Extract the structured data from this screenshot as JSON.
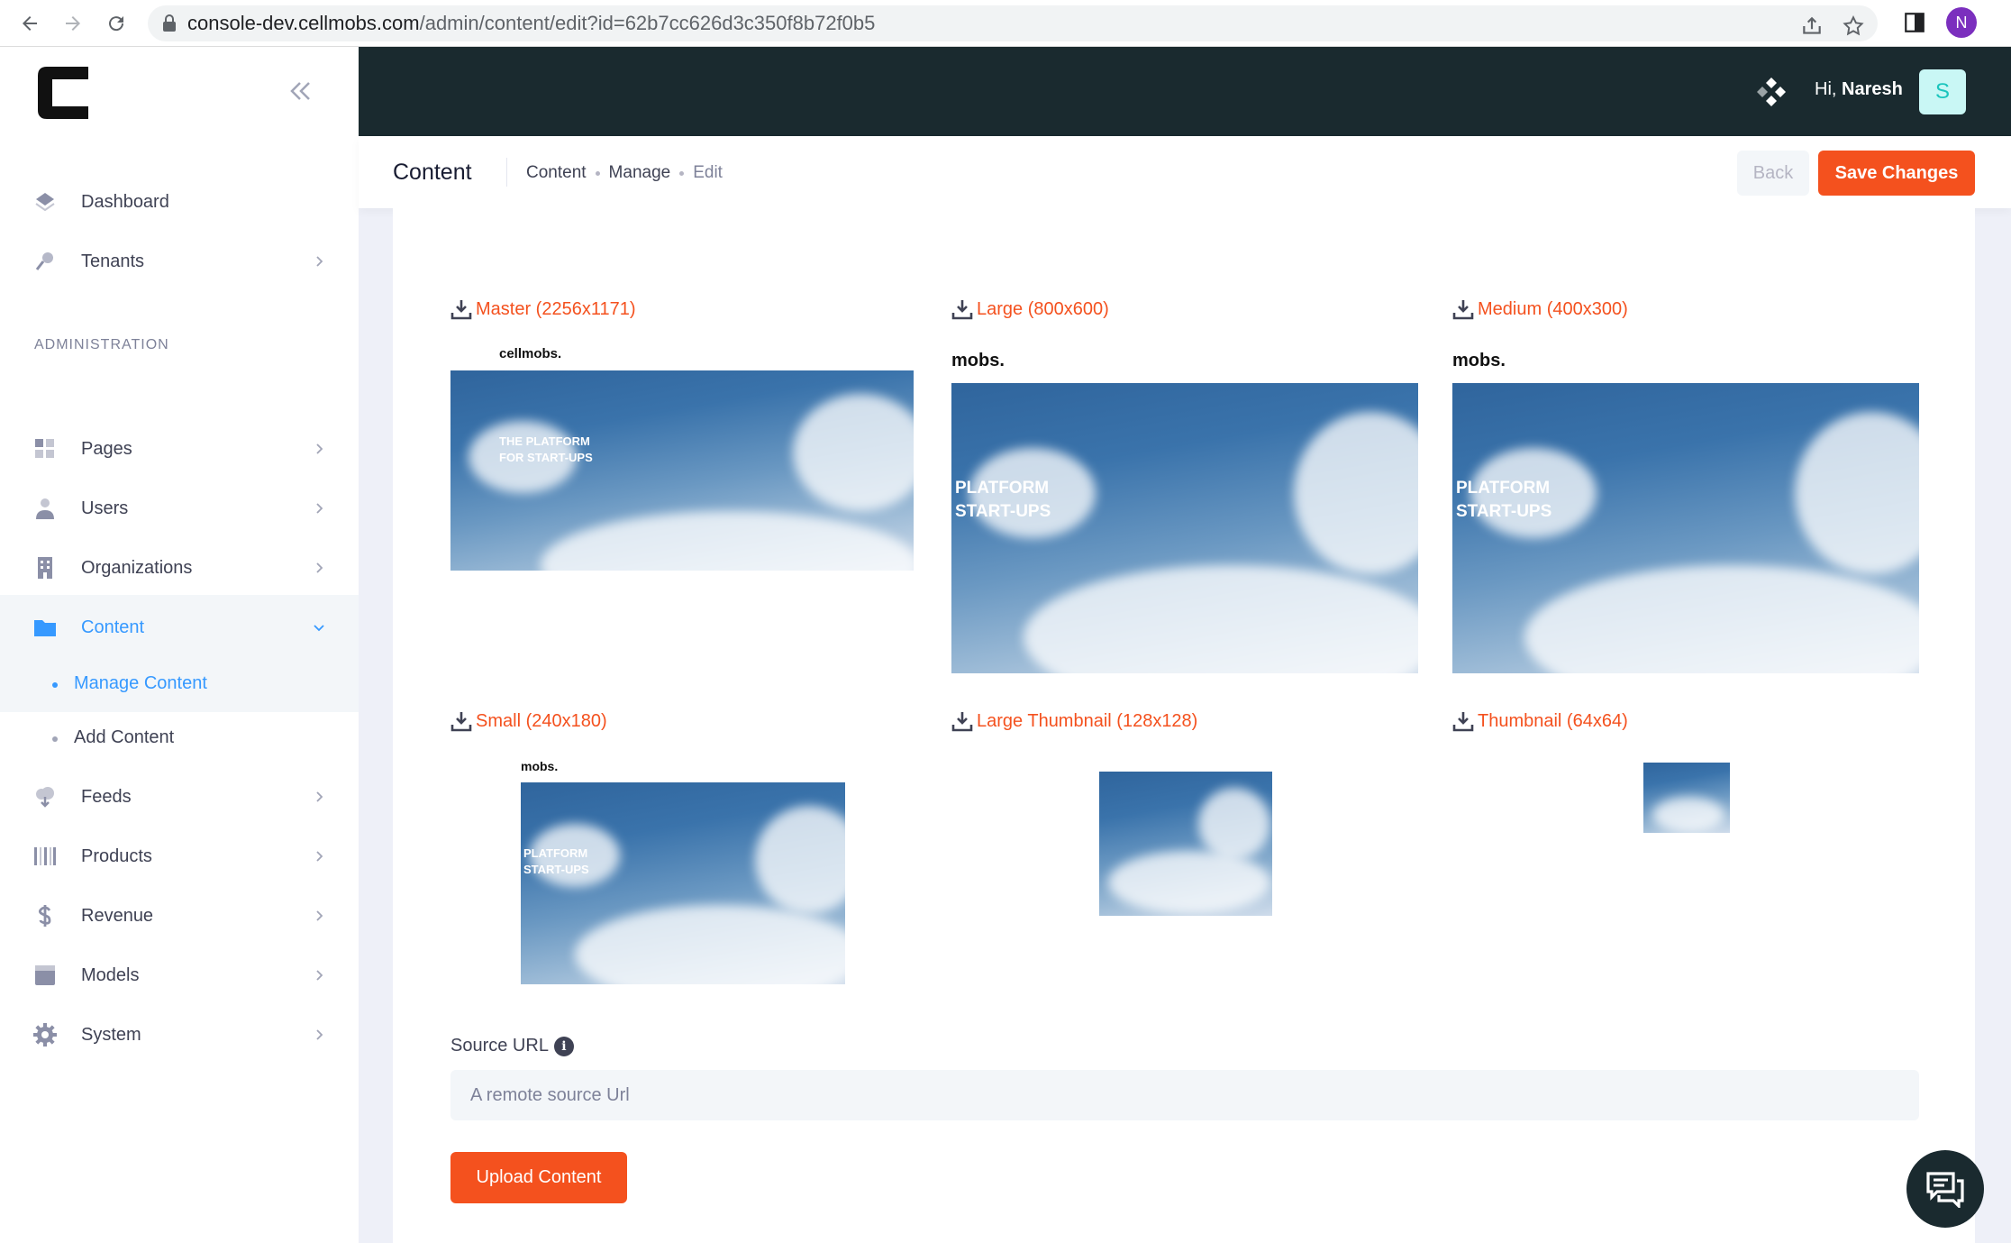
{
  "browser": {
    "url_host": "console-dev.cellmobs.com",
    "url_path": "/admin/content/edit?id=62b7cc626d3c350f8b72f0b5",
    "profile_initial": "N"
  },
  "sidebar": {
    "section_label": "ADMINISTRATION",
    "items": [
      {
        "label": "Dashboard"
      },
      {
        "label": "Tenants"
      },
      {
        "label": "Pages"
      },
      {
        "label": "Users"
      },
      {
        "label": "Organizations"
      },
      {
        "label": "Content"
      },
      {
        "label": "Feeds"
      },
      {
        "label": "Products"
      },
      {
        "label": "Revenue"
      },
      {
        "label": "Models"
      },
      {
        "label": "System"
      }
    ],
    "content_sub": [
      {
        "label": "Manage Content"
      },
      {
        "label": "Add Content"
      }
    ]
  },
  "topbar": {
    "greeting_prefix": "Hi,",
    "user_name": "Naresh",
    "avatar_initial": "S"
  },
  "subheader": {
    "title": "Content",
    "breadcrumbs": [
      "Content",
      "Manage",
      "Edit"
    ],
    "back_label": "Back",
    "save_label": "Save Changes"
  },
  "images": [
    {
      "label": "Master (2256x1171)",
      "brand": "cellmobs.",
      "hero": [
        "THE PLATFORM",
        "FOR START-UPS"
      ]
    },
    {
      "label": "Large (800x600)",
      "brand": "mobs.",
      "hero": [
        "PLATFORM",
        "START-UPS"
      ]
    },
    {
      "label": "Medium (400x300)",
      "brand": "mobs.",
      "hero": [
        "PLATFORM",
        "START-UPS"
      ]
    },
    {
      "label": "Small (240x180)",
      "brand": "mobs.",
      "hero": [
        "PLATFORM",
        "START-UPS"
      ]
    },
    {
      "label": "Large Thumbnail (128x128)"
    },
    {
      "label": "Thumbnail (64x64)"
    }
  ],
  "form": {
    "source_label": "Source URL",
    "info_glyph": "i",
    "source_placeholder": "A remote source Url",
    "upload_label": "Upload Content"
  },
  "colors": {
    "accent": "#f4511e",
    "active": "#3699ff",
    "header_bg": "#1a2a2f"
  }
}
